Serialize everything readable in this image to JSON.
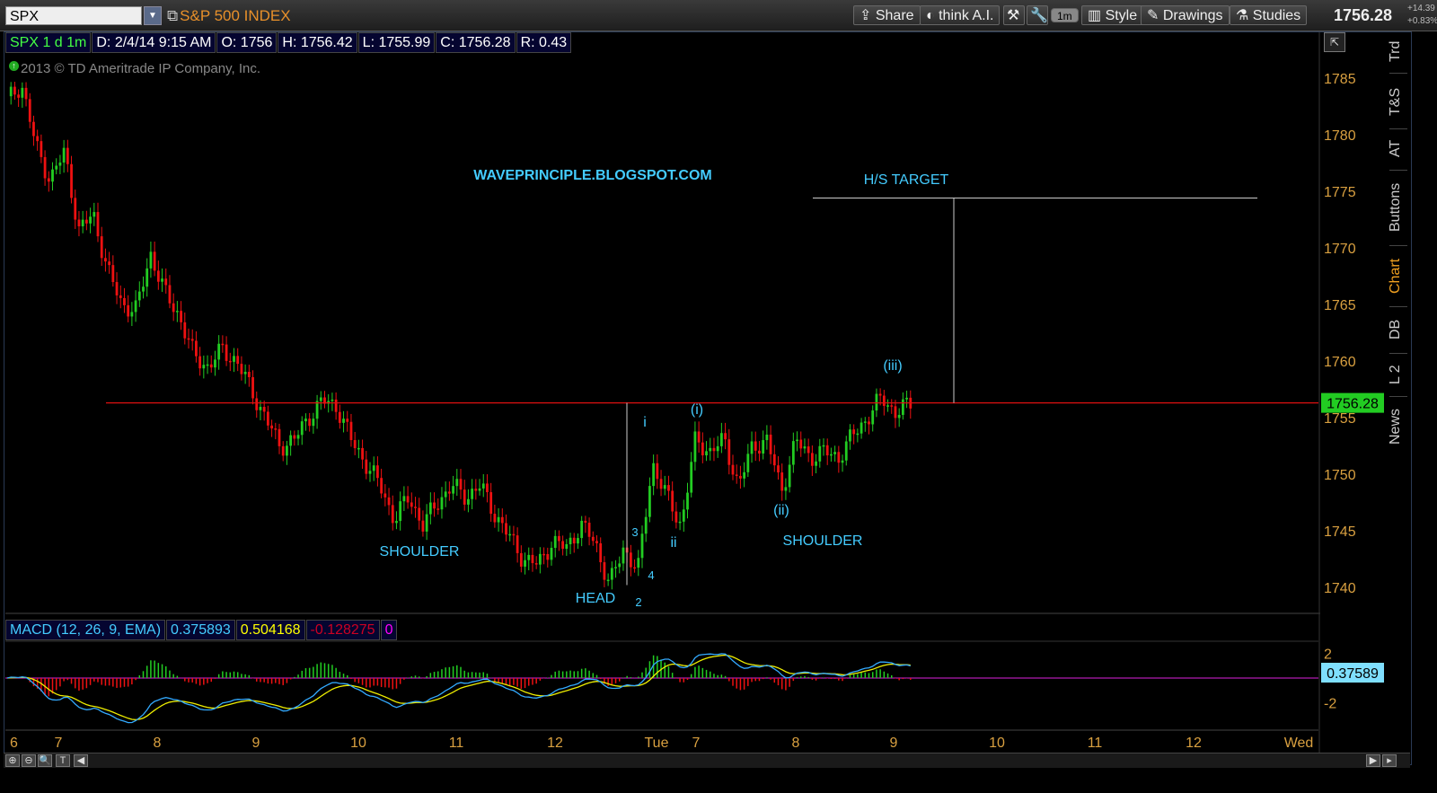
{
  "toolbar": {
    "symbol": "SPX",
    "symbol_name": "S&P 500 INDEX",
    "share": "Share",
    "think": "think A.I.",
    "interval": "1m",
    "style": "Style",
    "drawings": "Drawings",
    "studies": "Studies",
    "last": "1756.28",
    "change_abs": "+14.39",
    "change_pct": "+0.83%"
  },
  "info": {
    "symbol": "SPX 1 d 1m",
    "date": "D: 2/4/14 9:15 AM",
    "open": "O: 1756",
    "high": "H: 1756.42",
    "low": "L: 1755.99",
    "close": "C: 1756.28",
    "range": "R: 0.43"
  },
  "copyright": "2013 © TD Ameritrade IP Company, Inc.",
  "side_tabs": [
    "Trd",
    "T&S",
    "AT",
    "Buttons",
    "Chart",
    "DB",
    "L 2",
    "News"
  ],
  "macd": {
    "name": "MACD (12, 26, 9, EMA)",
    "value": "0.375893",
    "avg": "0.504168",
    "diff": "-0.128275",
    "zero": "0",
    "last_label": "0.37589",
    "ticks": [
      "2",
      "-2"
    ]
  },
  "colors": {
    "up": "#22cc22",
    "down": "#ee1111",
    "annotation": "#44ccff",
    "axis_text": "#d9a040",
    "neckline": "#dd1111",
    "macd_line": "#33aaff",
    "signal_line": "#eeee00",
    "price_label_bg": "#22cc22"
  },
  "chart_data": {
    "type": "candlestick",
    "symbol": "SPX",
    "interval": "1m",
    "ylim": [
      1737.5,
      1787.5
    ],
    "y_ticks": [
      1740,
      1745,
      1750,
      1755,
      1760,
      1765,
      1770,
      1775,
      1780,
      1785
    ],
    "x_ticks": [
      "6",
      "7",
      "8",
      "9",
      "10",
      "11",
      "12",
      "Tue",
      "7",
      "8",
      "9",
      "10",
      "11",
      "12",
      "Wed"
    ],
    "last_price": 1756.28,
    "close_path": [
      1783,
      1784.5,
      1779,
      1776,
      1778.5,
      1771.5,
      1773,
      1768,
      1765,
      1764.5,
      1769.5,
      1766,
      1764,
      1760.5,
      1759.5,
      1761,
      1760,
      1757.5,
      1755,
      1752.5,
      1753,
      1755,
      1756.5,
      1756,
      1753,
      1751,
      1749,
      1746,
      1748,
      1745.5,
      1747.5,
      1749,
      1748,
      1749,
      1746.5,
      1744.5,
      1742.5,
      1742,
      1744,
      1743.5,
      1745.5,
      1744,
      1740.2,
      1743.5,
      1741.5,
      1751,
      1748,
      1745.5,
      1753,
      1752,
      1753,
      1749,
      1752.5,
      1753,
      1748.5,
      1753,
      1751.5,
      1752,
      1751.5,
      1753.5,
      1755,
      1756.8,
      1755.4,
      1756.28
    ],
    "annotations": [
      {
        "text": "WAVEPRINCIPLE.BLOGSPOT.COM"
      },
      {
        "text": "H/S TARGET"
      },
      {
        "text": "SHOULDER"
      },
      {
        "text": "HEAD"
      },
      {
        "text": "SHOULDER"
      },
      {
        "text": "i"
      },
      {
        "text": "ii"
      },
      {
        "text": "(i)"
      },
      {
        "text": "(ii)"
      },
      {
        "text": "(iii)"
      },
      {
        "text": "2"
      },
      {
        "text": "3"
      },
      {
        "text": "4"
      }
    ],
    "neckline_price": 1756.3,
    "target_price": 1774.4,
    "macd_ylim": [
      -3.5,
      3.5
    ]
  }
}
